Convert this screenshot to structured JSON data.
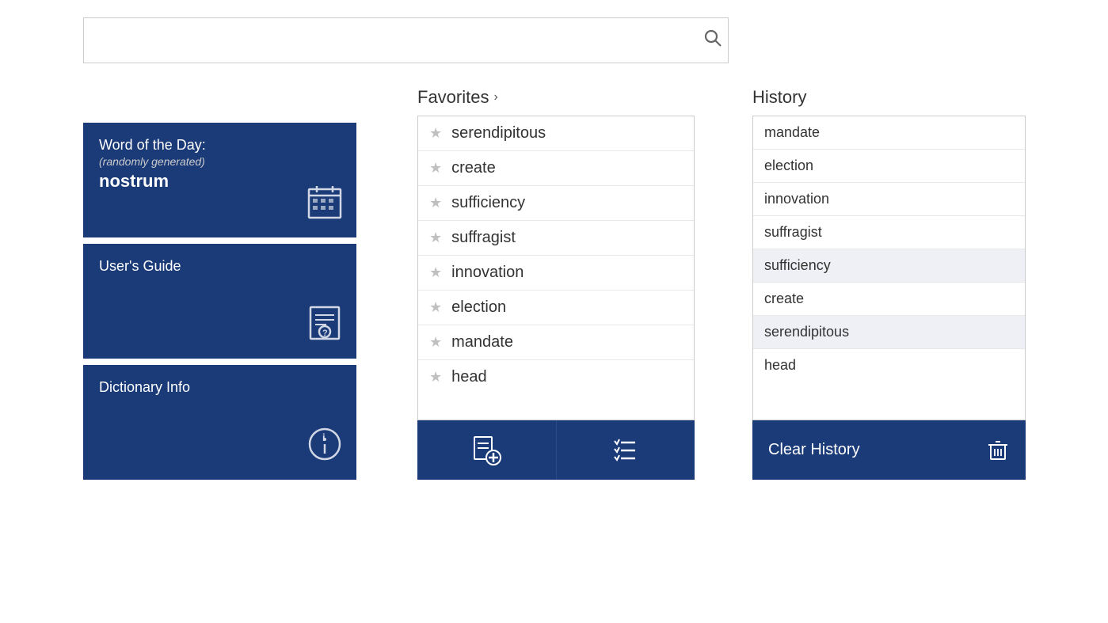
{
  "search": {
    "placeholder": "",
    "value": ""
  },
  "left_panel": {
    "word_of_day": {
      "title": "Word of the Day:",
      "subtitle": "(randomly generated)",
      "word": "nostrum"
    },
    "users_guide": {
      "title": "User's Guide"
    },
    "dictionary_info": {
      "title": "Dictionary Info"
    }
  },
  "favorites": {
    "header": "Favorites",
    "chevron": "›",
    "items": [
      "serendipitous",
      "create",
      "sufficiency",
      "suffragist",
      "innovation",
      "election",
      "mandate",
      "head"
    ],
    "add_button_label": "Add Favorite",
    "manage_button_label": "Manage Favorites"
  },
  "history": {
    "header": "History",
    "items": [
      {
        "word": "mandate",
        "highlighted": false
      },
      {
        "word": "election",
        "highlighted": false
      },
      {
        "word": "innovation",
        "highlighted": false
      },
      {
        "word": "suffragist",
        "highlighted": false
      },
      {
        "word": "sufficiency",
        "highlighted": true
      },
      {
        "word": "create",
        "highlighted": false
      },
      {
        "word": "serendipitous",
        "highlighted": true
      },
      {
        "word": "head",
        "highlighted": false
      }
    ],
    "clear_button": "Clear History"
  }
}
